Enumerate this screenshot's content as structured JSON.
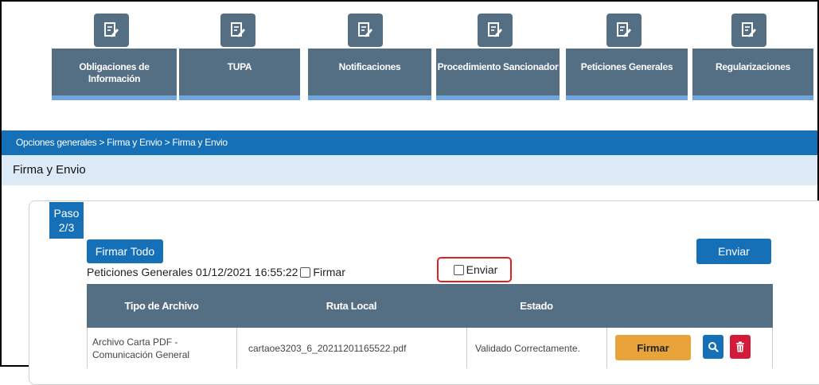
{
  "nav": {
    "items": [
      {
        "label_line1": "Obligaciones de",
        "label_line2": "Información",
        "icon": "edit-document-icon"
      },
      {
        "label_line1": "TUPA",
        "label_line2": "",
        "icon": "edit-document-icon"
      },
      {
        "label_line1": "Notificaciones",
        "label_line2": "",
        "icon": "edit-document-icon"
      },
      {
        "label_line1": "Procedimiento Sancionador",
        "label_line2": "",
        "icon": "edit-document-icon"
      },
      {
        "label_line1": "Peticiones Generales",
        "label_line2": "",
        "icon": "edit-document-icon"
      },
      {
        "label_line1": "Regularizaciones",
        "label_line2": "",
        "icon": "edit-document-icon"
      }
    ]
  },
  "breadcrumb": "Opciones generales > Firma y Envio > Firma y Envio",
  "page_title": "Firma y Envio",
  "step": {
    "line1": "Paso",
    "line2": "2/3"
  },
  "buttons": {
    "firmar_todo": "Firmar Todo",
    "enviar": "Enviar"
  },
  "document": {
    "description": "Peticiones Generales 01/12/2021 16:55:22",
    "firmar_label": "Firmar",
    "enviar_label": "Enviar"
  },
  "table": {
    "headers": [
      "Tipo de Archivo",
      "Ruta Local",
      "Estado",
      ""
    ],
    "rows": [
      {
        "tipo": "Archivo Carta PDF - Comunicación General",
        "ruta": "cartaoe3203_6_20211201165522.pdf",
        "estado": "Validado Correctamente.",
        "action_label": "Firmar"
      }
    ]
  },
  "colors": {
    "nav_card": "#546e84",
    "nav_underline": "#6ea6db",
    "primary_blue": "#1670b8",
    "title_bar": "#dceaf7",
    "firmar_orange": "#e8a43a",
    "delete_red": "#d31a3a",
    "highlight_red": "#e02020"
  }
}
